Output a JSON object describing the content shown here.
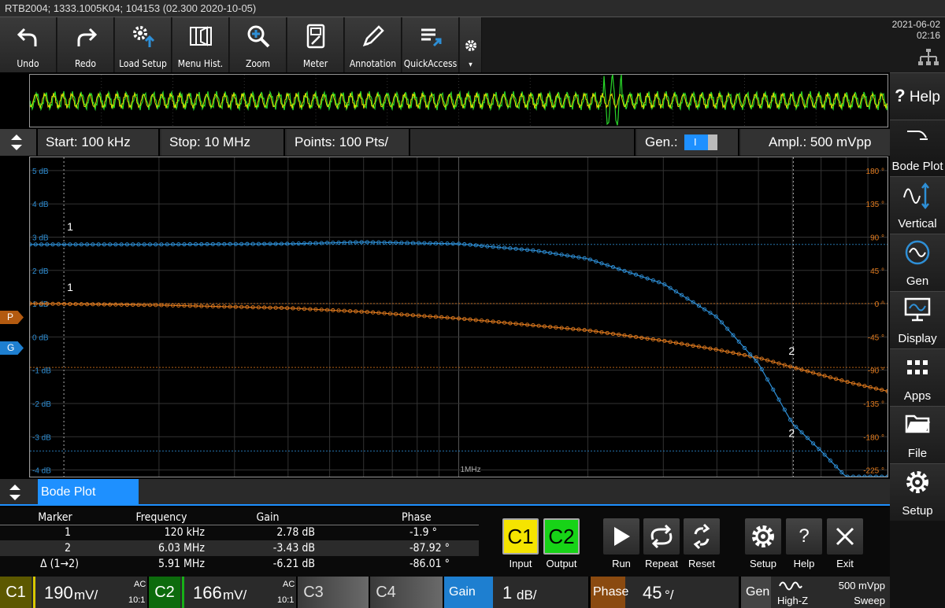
{
  "title": "RTB2004; 1333.1005K04; 104153 (02.300 2020-10-05)",
  "clock": {
    "date": "2021-06-02",
    "time": "02:16"
  },
  "toolbar": [
    {
      "label": "Undo",
      "icon": "undo-icon"
    },
    {
      "label": "Redo",
      "icon": "redo-icon"
    },
    {
      "label": "Load Setup",
      "icon": "load-setup-icon"
    },
    {
      "label": "Menu Hist.",
      "icon": "menu-history-icon"
    },
    {
      "label": "Zoom",
      "icon": "zoom-icon"
    },
    {
      "label": "Meter",
      "icon": "meter-icon"
    },
    {
      "label": "Annotation",
      "icon": "pencil-icon"
    },
    {
      "label": "QuickAccess",
      "icon": "quick-access-icon"
    }
  ],
  "infobar": {
    "start": "Start: 100 kHz",
    "stop": "Stop: 10 MHz",
    "points": "Points: 100 Pts/",
    "gen_label": "Gen.:",
    "gen_toggle": "I",
    "ampl": "Ampl.: 500 mVpp"
  },
  "sidebar": [
    {
      "label": "Help",
      "icon": "help-icon"
    },
    {
      "label": "Bode Plot",
      "icon": "bode-plot-icon"
    },
    {
      "label": "Vertical",
      "icon": "vertical-icon"
    },
    {
      "label": "Gen",
      "icon": "generator-icon"
    },
    {
      "label": "Display",
      "icon": "display-icon"
    },
    {
      "label": "Apps",
      "icon": "apps-icon"
    },
    {
      "label": "File",
      "icon": "folder-icon"
    },
    {
      "label": "Setup",
      "icon": "gear-icon"
    }
  ],
  "plot": {
    "left_axis_ticks": [
      "5 dB",
      "4 dB",
      "3 dB",
      "2 dB",
      "1 dB",
      "0 dB",
      "-1 dB",
      "-2 dB",
      "-3 dB",
      "-4 dB"
    ],
    "right_axis_ticks": [
      "180 °",
      "135 °",
      "90 °",
      "45 °",
      "0 °",
      "-45 °",
      "-90 °",
      "-135 °",
      "-180 °",
      "-225 °"
    ],
    "x_label": "1MHz",
    "phase_ref": "P",
    "gain_ref": "G",
    "marker1": "1",
    "marker2": "2"
  },
  "colors": {
    "gain": "#2e8fd6",
    "phase": "#e07a1e",
    "accent": "#1e90ff",
    "c1": "#f5e400",
    "c2": "#17a317"
  },
  "bode": {
    "tab": "Bode Plot",
    "headers": [
      "Marker",
      "Frequency",
      "Gain",
      "Phase"
    ],
    "rows": [
      [
        "1",
        "120 kHz",
        "2.78 dB",
        "-1.9 °"
      ],
      [
        "2",
        "6.03 MHz",
        "-3.43 dB",
        "-87.92 °"
      ],
      [
        "Δ (1→2)",
        "5.91 MHz",
        "-6.21 dB",
        "-86.01 °"
      ]
    ],
    "buttons": {
      "c1": "C1",
      "c1_label": "Input",
      "c2": "C2",
      "c2_label": "Output",
      "run": "Run",
      "repeat": "Repeat",
      "reset": "Reset",
      "setup": "Setup",
      "help": "Help",
      "help_glyph": "?",
      "exit": "Exit"
    }
  },
  "channels": {
    "c1": {
      "name": "C1",
      "value": "190",
      "unit": "mV/",
      "coupling": "AC",
      "ratio": "10:1"
    },
    "c2": {
      "name": "C2",
      "value": "166",
      "unit": "mV/",
      "coupling": "AC",
      "ratio": "10:1"
    },
    "c3": {
      "name": "C3"
    },
    "c4": {
      "name": "C4"
    },
    "gain": {
      "name": "Gain",
      "value": "1",
      "unit": "dB/"
    },
    "phase": {
      "name": "Phase",
      "value": "45",
      "unit": "°/"
    },
    "gen": {
      "name": "Gen",
      "mode": "High-Z",
      "ampl": "500 mVpp",
      "sweep": "Sweep"
    }
  },
  "chart_data": {
    "type": "line",
    "xscale": "log",
    "x_range": [
      100000,
      10000000
    ],
    "series": [
      {
        "name": "Gain",
        "unit": "dB",
        "ylim": [
          -4.2,
          5.4
        ],
        "x": [
          100000,
          200000,
          400000,
          600000,
          1000000,
          1500000,
          2000000,
          3000000,
          4000000,
          5000000,
          6000000,
          7000000,
          8000000,
          10000000
        ],
        "values": [
          2.78,
          2.78,
          2.8,
          2.85,
          2.8,
          2.6,
          2.35,
          1.6,
          0.6,
          -0.8,
          -2.6,
          -3.43,
          -4.2,
          -4.2
        ]
      },
      {
        "name": "Phase",
        "unit": "°",
        "ylim": [
          -235,
          195
        ],
        "x": [
          100000,
          200000,
          400000,
          600000,
          1000000,
          2000000,
          3000000,
          4000000,
          5000000,
          6030000,
          7000000,
          8000000,
          10000000
        ],
        "values": [
          -1.9,
          -4,
          -8,
          -13,
          -22,
          -38,
          -52,
          -64,
          -75,
          -87.92,
          -98,
          -107,
          -120
        ]
      }
    ]
  }
}
